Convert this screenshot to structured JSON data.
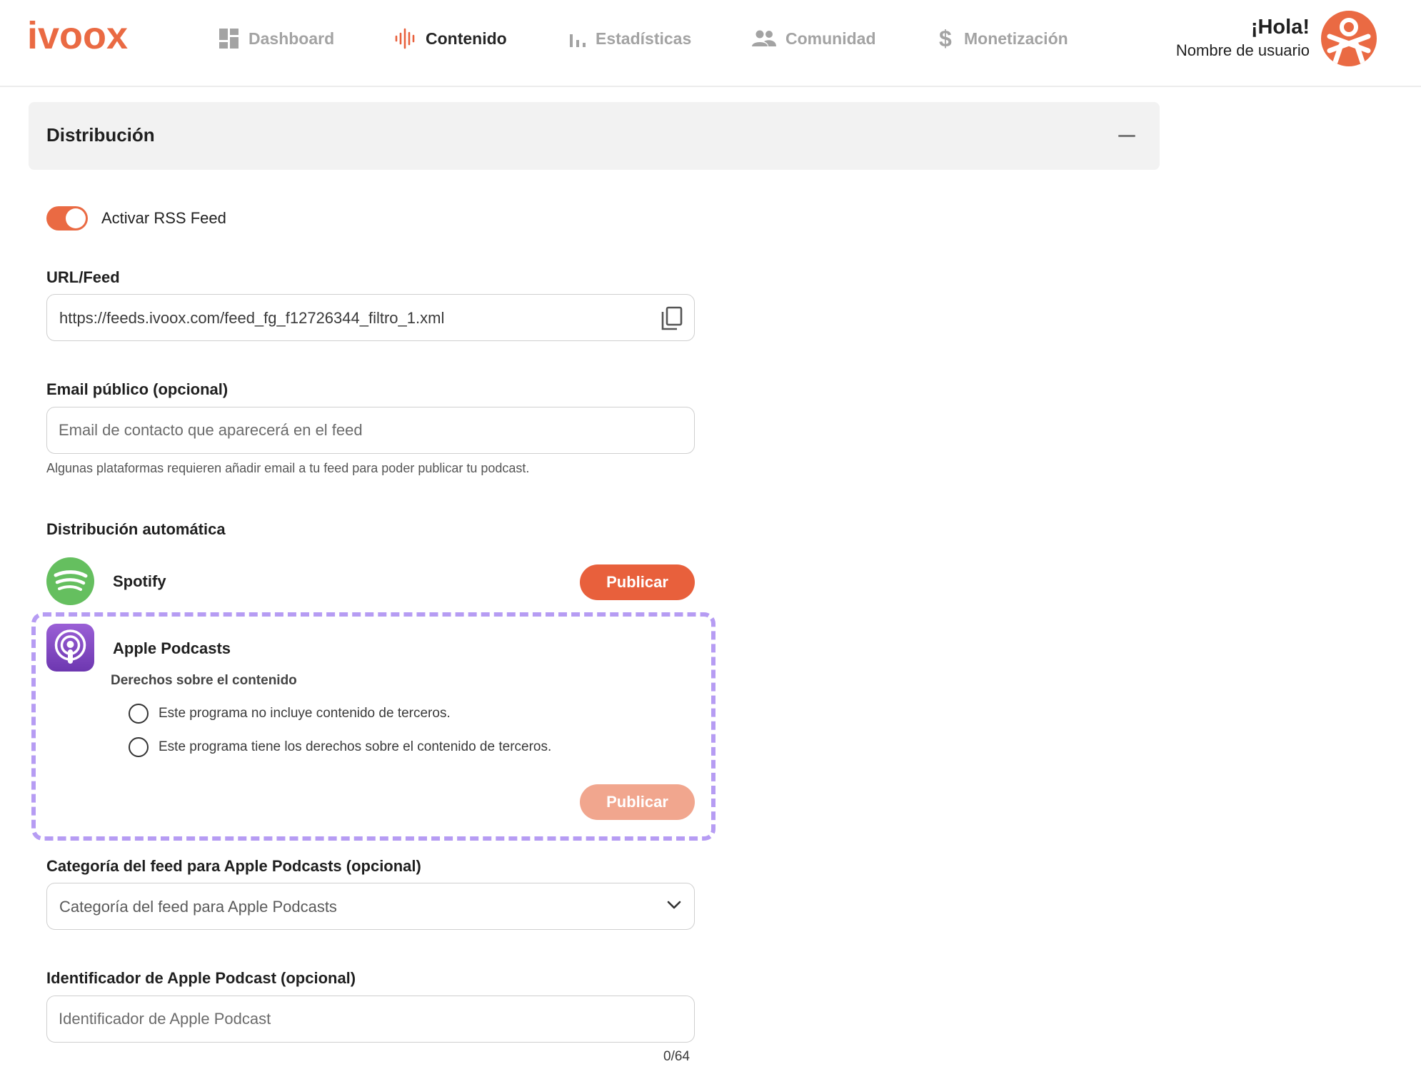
{
  "header": {
    "logo_text": "ivoox",
    "nav": [
      {
        "label": "Dashboard",
        "icon": "dashboard-icon",
        "active": false
      },
      {
        "label": "Contenido",
        "icon": "waveform-icon",
        "active": true
      },
      {
        "label": "Estadísticas",
        "icon": "bar-chart-icon",
        "active": false
      },
      {
        "label": "Comunidad",
        "icon": "people-icon",
        "active": false
      },
      {
        "label": "Monetización",
        "icon": "dollar-icon",
        "active": false
      }
    ],
    "greeting": "¡Hola!",
    "username": "Nombre de usuario"
  },
  "section": {
    "title": "Distribución"
  },
  "rss": {
    "toggle_label": "Activar RSS Feed",
    "enabled": true
  },
  "url_feed": {
    "label": "URL/Feed",
    "value": "https://feeds.ivoox.com/feed_fg_f12726344_filtro_1.xml"
  },
  "email": {
    "label": "Email público (opcional)",
    "placeholder": "Email de contacto que aparecerá en el feed",
    "help": "Algunas plataformas requieren añadir email a tu feed para poder publicar tu podcast."
  },
  "auto_distribution": {
    "heading": "Distribución automática",
    "spotify": {
      "name": "Spotify",
      "button": "Publicar"
    },
    "apple": {
      "name": "Apple Podcasts",
      "rights_label": "Derechos sobre el contenido",
      "options": [
        "Este programa no incluye contenido de terceros.",
        "Este programa tiene los derechos sobre el contenido de terceros."
      ],
      "button": "Publicar"
    }
  },
  "apple_category": {
    "label": "Categoría del feed para Apple Podcasts (opcional)",
    "placeholder": "Categoría del feed para Apple Podcasts"
  },
  "apple_id": {
    "label": "Identificador de Apple Podcast (opcional)",
    "placeholder": "Identificador de Apple Podcast",
    "counter": "0/64"
  },
  "colors": {
    "accent": "#e8603c",
    "accent_disabled": "#f1a68e",
    "highlight": "#b69cf3",
    "spotify": "#65bf5f",
    "apple": "#8b4fc6"
  }
}
